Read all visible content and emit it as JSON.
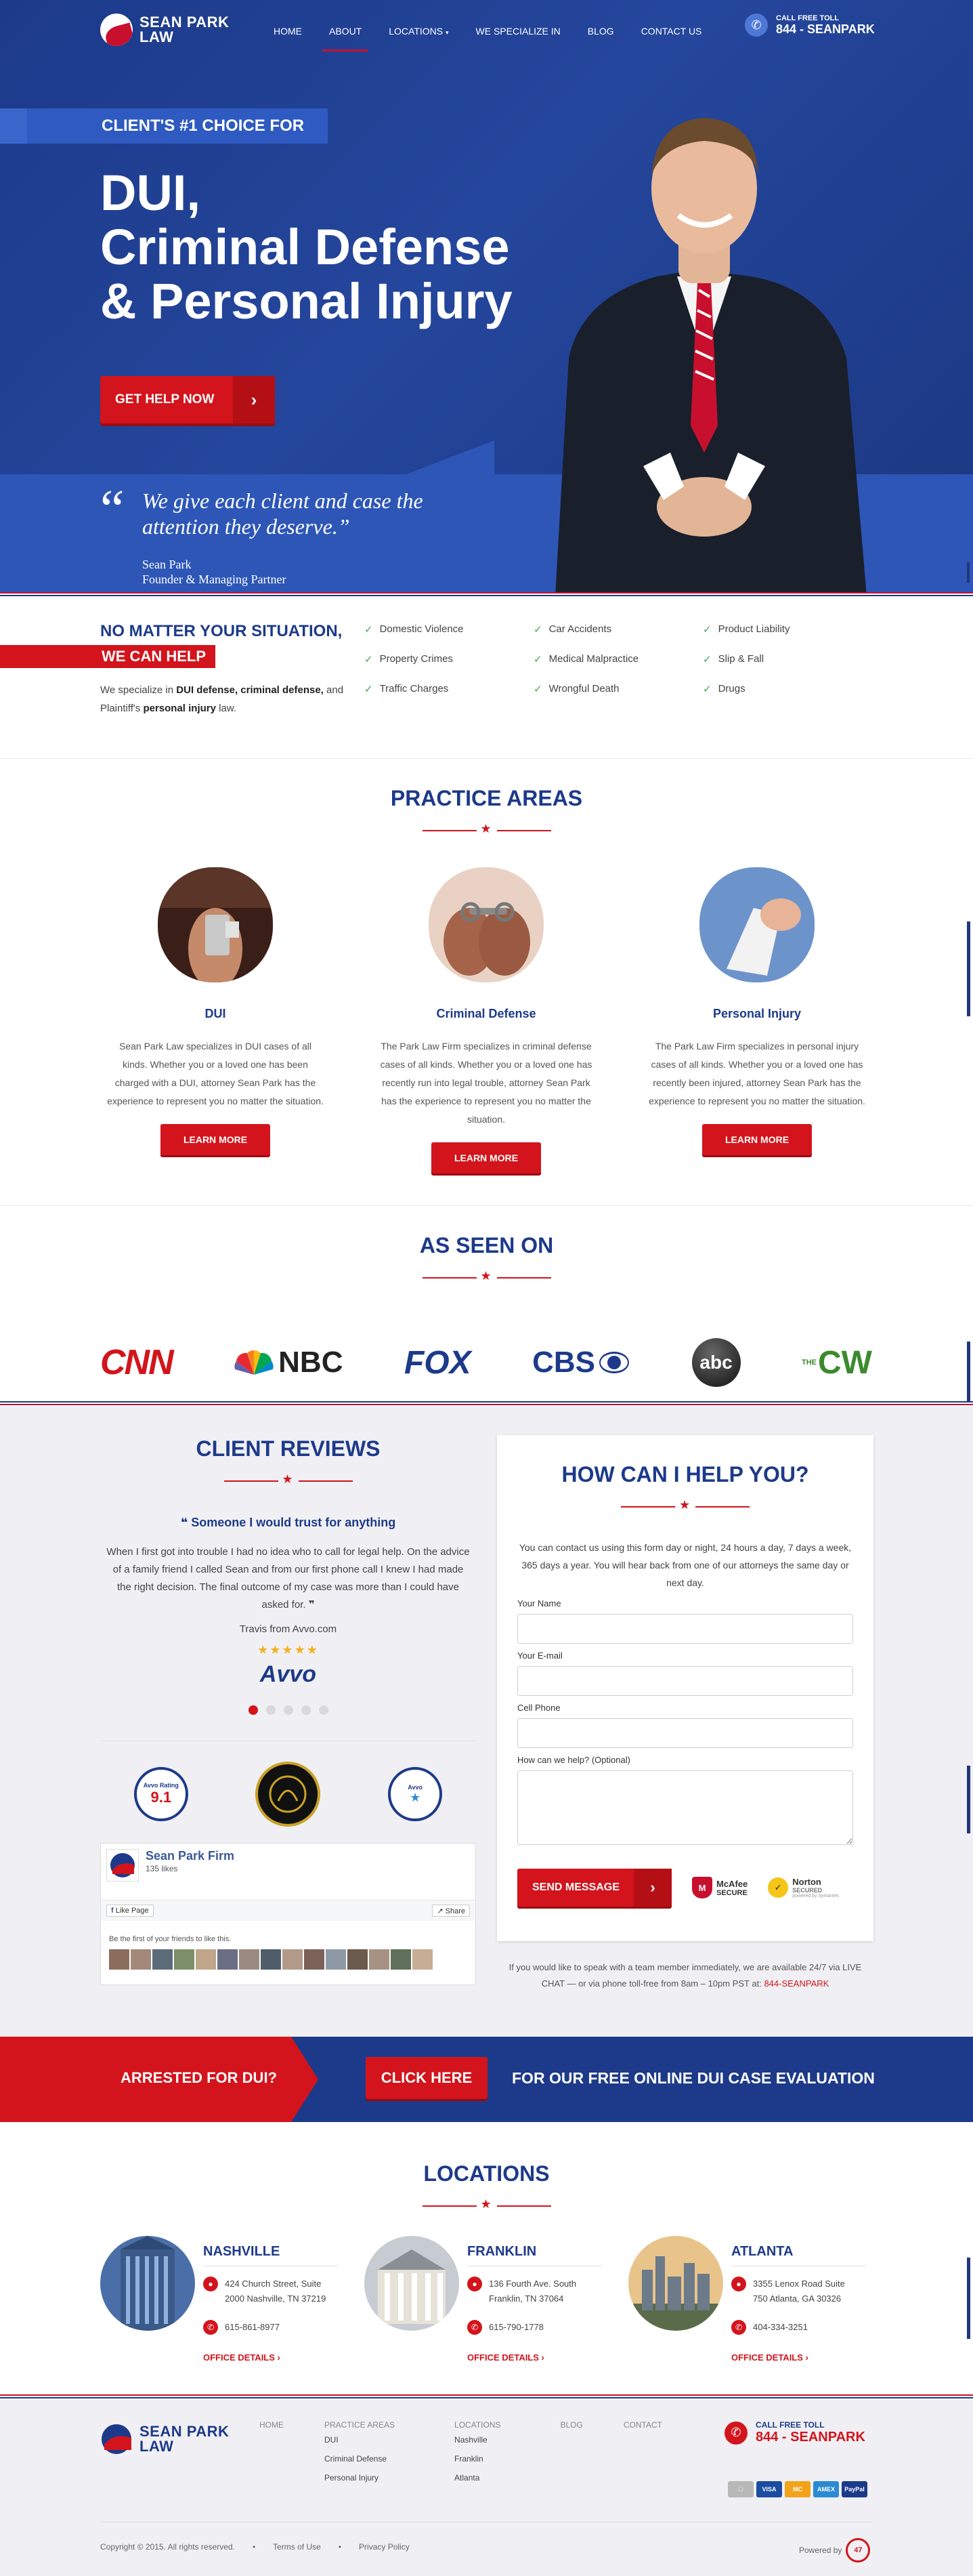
{
  "brand": {
    "name_line1": "SEAN PARK",
    "name_line2": "LAW"
  },
  "nav": {
    "items": [
      "HOME",
      "ABOUT",
      "LOCATIONS",
      "WE SPECIALIZE IN",
      "BLOG",
      "CONTACT US"
    ],
    "active": "ABOUT",
    "call_label": "CALL FREE TOLL",
    "call_number": "844 - SEANPARK"
  },
  "hero": {
    "ribbon": "CLIENT'S #1 CHOICE FOR",
    "headline_1": "DUI,",
    "headline_2": "Criminal Defense",
    "headline_3": "& Personal Injury",
    "button": "GET HELP NOW",
    "quote_mark": "“",
    "quote": "We give each client and case the attention they deserve.”",
    "author_name": "Sean Park",
    "author_title": "Founder & Managing Partner"
  },
  "situation": {
    "title": "NO MATTER YOUR SITUATION,",
    "badge": "WE CAN HELP",
    "desc_1": "We specialize in ",
    "desc_b1": "DUI defense, criminal defense,",
    "desc_2": " and Plaintiff's ",
    "desc_b2": "personal injury",
    "desc_3": " law.",
    "items": [
      "Domestic Violence",
      "Car Accidents",
      "Product Liability",
      "Property Crimes",
      "Medical Malpractice",
      "Slip & Fall",
      "Traffic Charges",
      "Wrongful Death",
      "Drugs"
    ]
  },
  "practice": {
    "title": "PRACTICE AREAS",
    "areas": [
      {
        "name": "DUI",
        "desc": "Sean Park Law specializes in DUI cases of all kinds. Whether you or a loved one has been charged with a DUI, attorney Sean Park has the experience to represent you no matter the situation.",
        "button": "LEARN MORE"
      },
      {
        "name": "Criminal Defense",
        "desc": "The Park Law Firm specializes in criminal defense cases of all kinds. Whether you or a loved one has recently run into legal trouble, attorney Sean Park has the experience to represent you no matter the situation.",
        "button": "LEARN MORE"
      },
      {
        "name": "Personal Injury",
        "desc": "The Park Law Firm specializes in personal injury cases of all kinds. Whether you or a loved one has recently been injured, attorney Sean Park has the experience to represent you no matter the situation.",
        "button": "LEARN MORE"
      }
    ]
  },
  "seen": {
    "title": "AS SEEN ON",
    "logos": [
      "CNN",
      "NBC",
      "FOX",
      "CBS",
      "abc",
      "CW"
    ],
    "cw_prefix": "THE"
  },
  "reviews": {
    "title": "CLIENT REVIEWS",
    "headline": "Someone I would trust for anything",
    "text": "When I first got into trouble I had no idea who to call for legal help. On the advice of a family friend I called Sean and from our first phone call I knew I had made the right decision. The final outcome of my case was more than I could have asked for.",
    "source": "Travis from Avvo.com",
    "stars": "★★★★★",
    "avvo": "Avvo",
    "badge_1": "9.1",
    "badge_1_label": "Avvo Rating",
    "badge_3_label": "Avvo"
  },
  "facebook": {
    "name": "Sean Park Firm",
    "likes": "135 likes",
    "like_btn": "Like Page",
    "share_btn": "Share",
    "friends": "Be the first of your friends to like this."
  },
  "form": {
    "title": "HOW CAN I HELP YOU?",
    "intro": "You can contact us using this form day or night, 24 hours a day, 7 days a week, 365 days a year. You will hear back from one of our attorneys the same day or next day.",
    "name_label": "Your Name",
    "email_label": "Your E-mail",
    "phone_label": "Cell Phone",
    "message_label": "How can we help? (Optional)",
    "send": "SEND MESSAGE",
    "mcafee_1": "McAfee",
    "mcafee_2": "SECURE",
    "norton_1": "Norton",
    "norton_2": "SECURED",
    "norton_3": "powered by Symantec",
    "note": "If you would like to speak with a team member immediately, we are available 24/7 via LIVE CHAT — or via phone toll-free from 8am – 10pm PST at: ",
    "note_phone": "844-SEANPARK"
  },
  "cta": {
    "left": "ARRESTED FOR DUI?",
    "button": "CLICK HERE",
    "right": "FOR OUR FREE ONLINE DUI CASE EVALUATION"
  },
  "locations": {
    "title": "LOCATIONS",
    "items": [
      {
        "name": "NASHVILLE",
        "address_1": "424 Church Street, Suite",
        "address_2": "2000 Nashville, TN 37219",
        "phone": "615-861-8977",
        "link": "OFFICE DETAILS ›"
      },
      {
        "name": "FRANKLIN",
        "address_1": "136 Fourth Ave. South",
        "address_2": "Franklin, TN 37064",
        "phone": "615-790-1778",
        "link": "OFFICE DETAILS ›"
      },
      {
        "name": "ATLANTA",
        "address_1": "3355 Lenox Road Suite",
        "address_2": "750 Atlanta, GA 30326",
        "phone": "404-334-3251",
        "link": "OFFICE DETAILS ›"
      }
    ]
  },
  "footer": {
    "cols": [
      {
        "title": "HOME",
        "links": []
      },
      {
        "title": "PRACTICE AREAS",
        "links": [
          "DUI",
          "Criminal Defense",
          "Personal Injury"
        ]
      },
      {
        "title": "LOCATIONS",
        "links": [
          "Nashville",
          "Franklin",
          "Atlanta"
        ]
      },
      {
        "title": "BLOG",
        "links": []
      },
      {
        "title": "CONTACT",
        "links": []
      }
    ],
    "call_label": "CALL FREE TOLL",
    "call_number": "844 - SEANPARK",
    "cards": [
      "VISA",
      "MC",
      "AMEX",
      "PayPal"
    ],
    "copyright": "Copyright © 2015. All rights reserved.",
    "terms": "Terms of Use",
    "privacy": "Privacy Policy",
    "powered": "Powered by"
  },
  "colors": {
    "navy": "#1d3a8a",
    "red": "#d3141c",
    "blue": "#2d56b7",
    "check": "#3da84a"
  }
}
